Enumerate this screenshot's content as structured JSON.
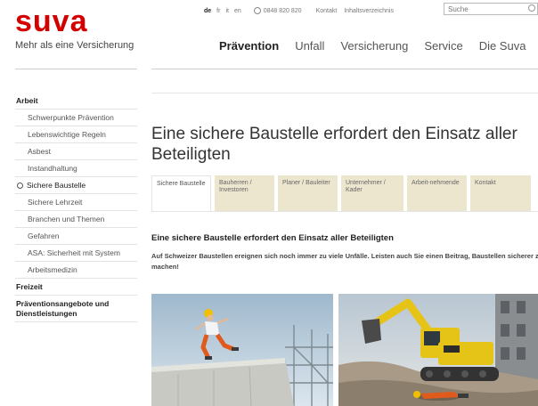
{
  "header": {
    "logo": "suva",
    "tagline": "Mehr als eine Versicherung",
    "languages": [
      "de",
      "fr",
      "it",
      "en"
    ],
    "phone": "0848 820 820",
    "links": [
      "Kontakt",
      "Inhaltsverzeichnis"
    ],
    "search_placeholder": "Suche"
  },
  "nav": [
    "Prävention",
    "Unfall",
    "Versicherung",
    "Service",
    "Die Suva"
  ],
  "sidebar": {
    "items": [
      {
        "label": "Arbeit"
      },
      {
        "label": "Schwerpunkte Prävention"
      },
      {
        "label": "Lebenswichtige Regeln"
      },
      {
        "label": "Asbest"
      },
      {
        "label": "Instandhaltung"
      },
      {
        "label": "Sichere Baustelle"
      },
      {
        "label": "Sichere Lehrzeit"
      },
      {
        "label": "Branchen und Themen"
      },
      {
        "label": "Gefahren"
      },
      {
        "label": "ASA: Sicherheit mit System"
      },
      {
        "label": "Arbeitsmedizin"
      },
      {
        "label": "Freizeit"
      },
      {
        "label": "Präventionsangebote und Dienstleistungen"
      }
    ]
  },
  "main": {
    "title": "Eine sichere Baustelle erfordert den Einsatz aller Beteiligten",
    "tabs": [
      {
        "label": "Sichere Baustelle"
      },
      {
        "label": "Bauherren / Investoren"
      },
      {
        "label": "Planer / Bauleiter"
      },
      {
        "label": "Unternehmer / Kader"
      },
      {
        "label": "Arbeit-nehmende"
      },
      {
        "label": "Kontakt"
      }
    ],
    "subtitle": "Eine sichere Baustelle erfordert den Einsatz aller Beteiligten",
    "intro": "Auf Schweizer Baustellen ereignen sich noch immer zu viele Unfälle. Leisten auch Sie einen Beitrag, Baustellen sicherer zu machen!"
  },
  "colors": {
    "brand": "#d40000",
    "tab_background": "#ece6cf",
    "machine_yellow": "#e6c417"
  }
}
